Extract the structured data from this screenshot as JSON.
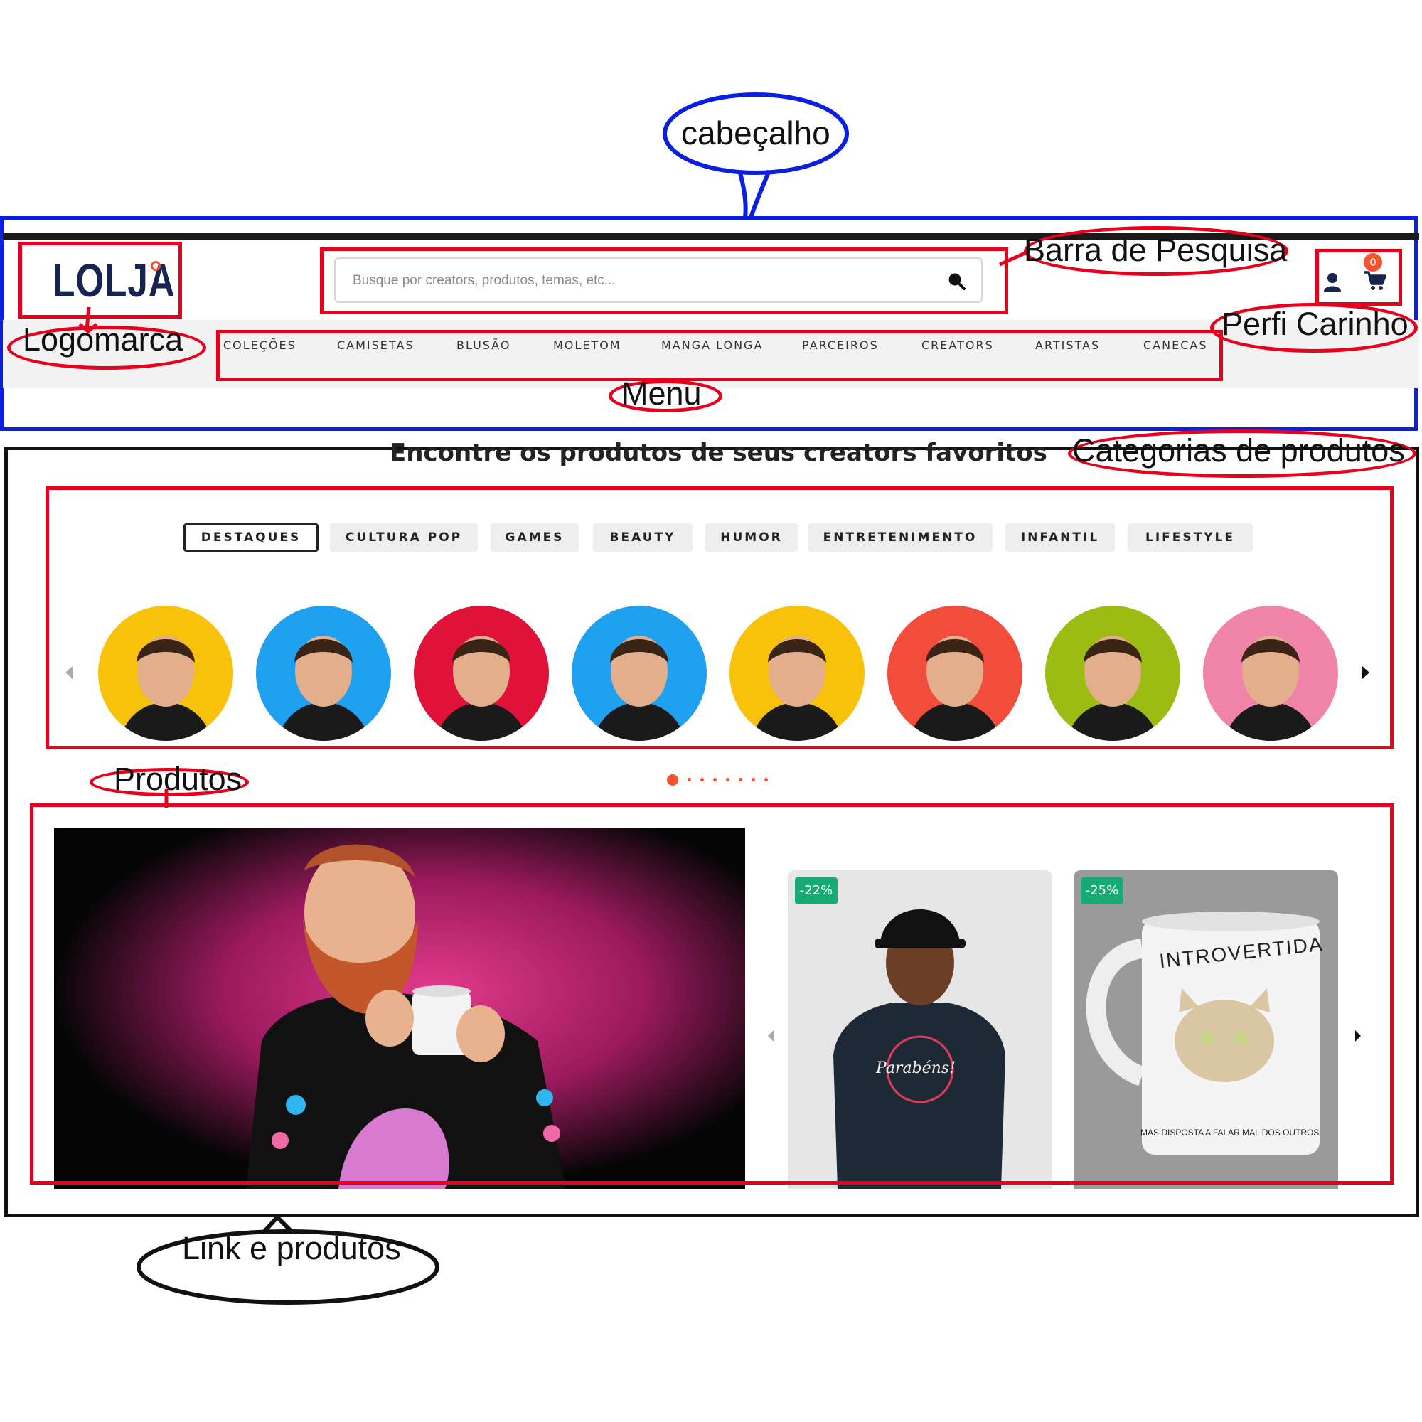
{
  "annotations": {
    "header": "cabeçalho",
    "logo": "Logomarca",
    "search_bar": "Barra de Pesquisa",
    "profile_cart": "Perfi Carinho",
    "menu": "Menu",
    "categories": "Categorias de produtos",
    "products": "Produtos",
    "links_products": "Link e produtos"
  },
  "header": {
    "logo_text": "LOLJA",
    "search_placeholder": "Busque por creators, produtos, temas, etc...",
    "cart_count": "0",
    "menu": [
      "COLEÇÕES",
      "CAMISETAS",
      "BLUSÃO",
      "MOLETOM",
      "MANGA LONGA",
      "PARCEIROS",
      "CREATORS",
      "ARTISTAS",
      "CANECAS"
    ]
  },
  "main": {
    "heading": "Encontre os produtos de seus creators favoritos",
    "category_tabs": [
      {
        "label": "DESTAQUES",
        "active": true
      },
      {
        "label": "CULTURA POP",
        "active": false
      },
      {
        "label": "GAMES",
        "active": false
      },
      {
        "label": "BEAUTY",
        "active": false
      },
      {
        "label": "HUMOR",
        "active": false
      },
      {
        "label": "ENTRETENIMENTO",
        "active": false
      },
      {
        "label": "INFANTIL",
        "active": false
      },
      {
        "label": "LIFESTYLE",
        "active": false
      }
    ],
    "creator_bg_colors": [
      "#f8c20a",
      "#1fa0f0",
      "#e0123a",
      "#1fa0f0",
      "#f8c20a",
      "#f24c3d",
      "#9cbc14",
      "#f084a8"
    ],
    "carousel_pages": 8,
    "carousel_active_page": 1,
    "products": [
      {
        "badge": "-22%",
        "mug_text": "Parabéns!"
      },
      {
        "badge": "-25%",
        "mug_text": "INTROVERTIDA",
        "mug_subtext": "MAS DISPOSTA A FALAR MAL DOS OUTROS"
      }
    ]
  },
  "colors": {
    "accent": "#f2542d",
    "brand": "#162550",
    "discount": "#19a974"
  }
}
